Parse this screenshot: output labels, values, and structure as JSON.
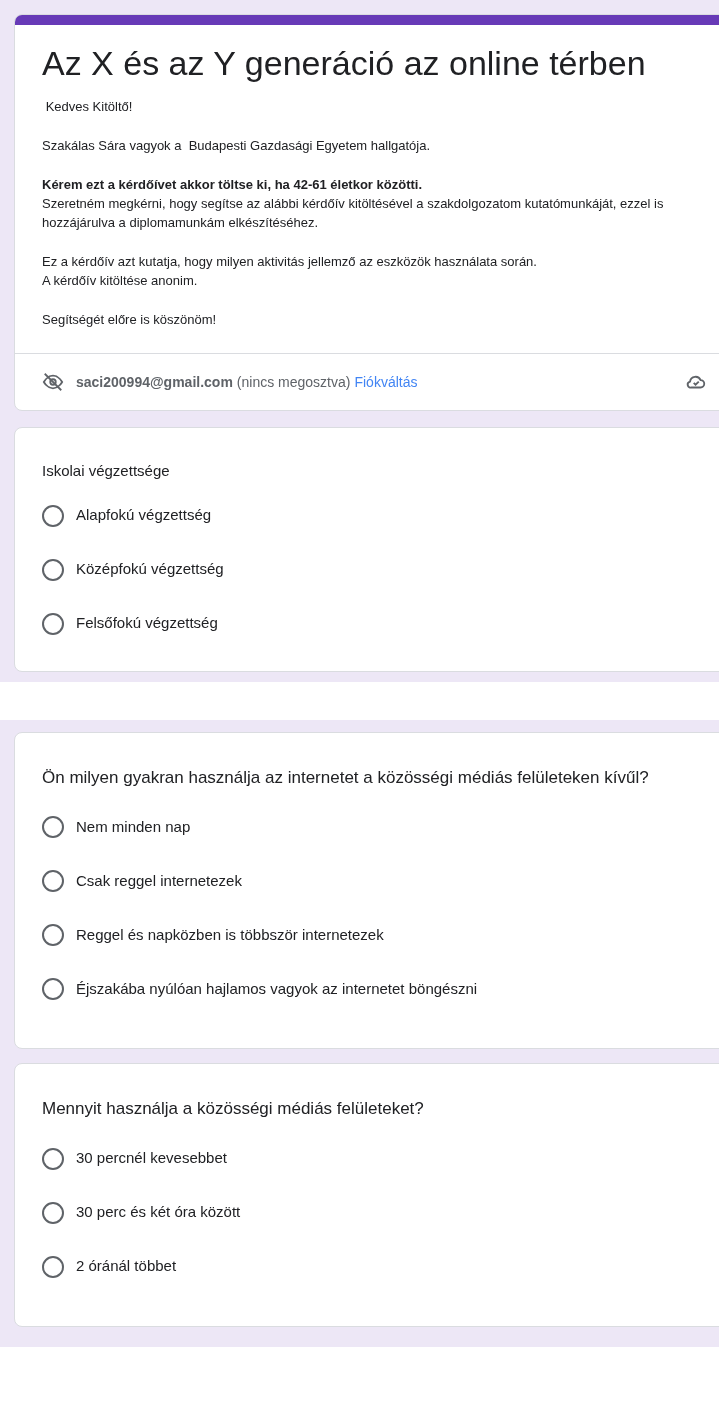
{
  "header": {
    "title": "Az X és az Y generáció az online térben",
    "paragraphs": [
      " Kedves Kitöltő!",
      "Szakálas Sára vagyok a  Budapesti Gazdasági Egyetem hallgatója.",
      "**Kérem ezt a kérdőívet akkor töltse ki, ha 42-61 életkor közötti.**\nSzeretném megkérni, hogy segítse az alábbi kérdőív kitöltésével a szakdolgozatom kutatómunkáját, ezzel is hozzájárulva a diplomamunkám elkészítéséhez.",
      "Ez a kérdőív azt kutatja, hogy milyen aktivitás jellemző az eszközök használata során.\nA kérdőív kitöltése anonim.",
      "Segítségét előre is köszönöm!"
    ],
    "account": {
      "email": "saci200994@gmail.com",
      "note": "(nincs megosztva)",
      "switch_link": "Fiókváltás"
    }
  },
  "sections": [
    {
      "questions": [
        {
          "title": "Iskolai végzettsége",
          "options": [
            {
              "label": "Alapfokú végzettség",
              "selected": false
            },
            {
              "label": "Középfokú végzettség",
              "selected": false
            },
            {
              "label": "Felsőfokú végzettség",
              "selected": false
            }
          ]
        }
      ]
    },
    {
      "questions": [
        {
          "title": "Ön milyen gyakran használja az internetet a közösségi médiás felületeken kívűl?",
          "options": [
            {
              "label": "Nem minden nap",
              "selected": false
            },
            {
              "label": "Csak reggel internetezek",
              "selected": false
            },
            {
              "label": "Reggel és napközben is többször internetezek",
              "selected": false
            },
            {
              "label": "Éjszakába nyúlóan hajlamos vagyok az internetet böngészni",
              "selected": false
            }
          ]
        },
        {
          "title": "Mennyit használja a közösségi médiás felületeket?",
          "options": [
            {
              "label": "30 percnél kevesebbet",
              "selected": false
            },
            {
              "label": "30 perc és két óra között",
              "selected": false
            },
            {
              "label": "2 óránál többet",
              "selected": false
            }
          ]
        }
      ]
    }
  ]
}
